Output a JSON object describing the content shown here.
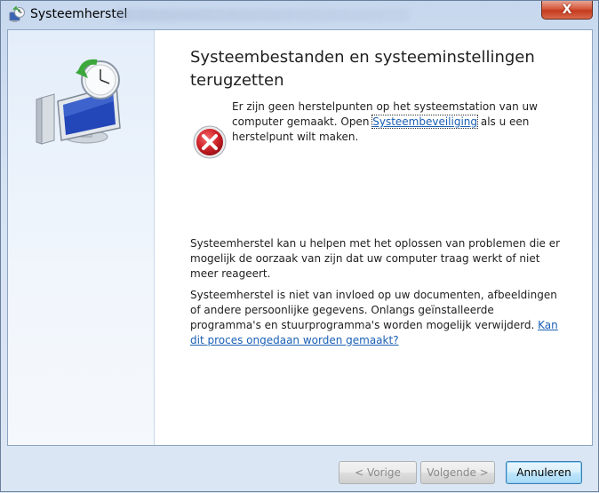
{
  "window": {
    "title": "Systeemherstel",
    "close_label": "X"
  },
  "content": {
    "heading": "Systeembestanden en systeeminstellingen terugzetten",
    "error": {
      "text_before": "Er zijn geen herstelpunten op het systeemstation van uw computer gemaakt. Open ",
      "link": "Systeembeveiliging",
      "text_after": " als u een herstelpunt wilt maken."
    },
    "paragraph1": "Systeemherstel kan u helpen met het oplossen van problemen die er mogelijk de oorzaak van zijn dat uw computer traag werkt of niet meer reageert.",
    "paragraph2": {
      "text": "Systeemherstel is niet van invloed op uw documenten, afbeeldingen of andere persoonlijke gegevens. Onlangs geïnstalleerde programma's en stuurprogramma's worden mogelijk verwijderd. ",
      "link": "Kan dit proces ongedaan worden gemaakt?"
    }
  },
  "buttons": {
    "prev": "< Vorige",
    "next": "Volgende >",
    "cancel": "Annuleren"
  },
  "colors": {
    "link": "#1a5fb4",
    "error_red": "#c8171d"
  },
  "icons": {
    "title": "system-restore-icon",
    "hero": "system-restore-monitor-clock-icon",
    "error": "error-icon"
  }
}
